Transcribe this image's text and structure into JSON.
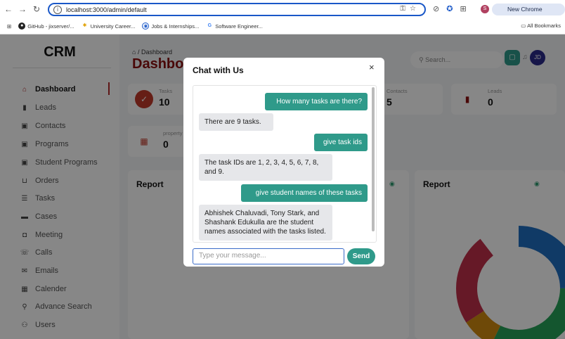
{
  "browser": {
    "url": "localhost:3000/admin/default",
    "update_label": "New Chrome available",
    "profile_initial": "S",
    "bookmarks": [
      "GitHub - jixserver/...",
      "University Career...",
      "Jobs & Internships...",
      "Software Engineer..."
    ],
    "all_bookmarks": "All Bookmarks"
  },
  "sidebar": {
    "logo": "CRM",
    "items": [
      {
        "label": "Dashboard",
        "icon": "home-icon",
        "glyph": "⌂",
        "active": true
      },
      {
        "label": "Leads",
        "icon": "bar-chart-icon",
        "glyph": "▮"
      },
      {
        "label": "Contacts",
        "icon": "contact-icon",
        "glyph": "▣"
      },
      {
        "label": "Programs",
        "icon": "program-icon",
        "glyph": "▣"
      },
      {
        "label": "Student Programs",
        "icon": "student-program-icon",
        "glyph": "▣"
      },
      {
        "label": "Orders",
        "icon": "cart-icon",
        "glyph": "⊔"
      },
      {
        "label": "Tasks",
        "icon": "task-list-icon",
        "glyph": "☰"
      },
      {
        "label": "Cases",
        "icon": "briefcase-icon",
        "glyph": "▬"
      },
      {
        "label": "Meeting",
        "icon": "video-icon",
        "glyph": "◘"
      },
      {
        "label": "Calls",
        "icon": "phone-icon",
        "glyph": "☏"
      },
      {
        "label": "Emails",
        "icon": "mail-icon",
        "glyph": "✉"
      },
      {
        "label": "Calender",
        "icon": "calendar-icon",
        "glyph": "▦"
      },
      {
        "label": "Advance Search",
        "icon": "search-icon",
        "glyph": "⚲"
      },
      {
        "label": "Users",
        "icon": "users-icon",
        "glyph": "⚇"
      }
    ]
  },
  "header": {
    "breadcrumb": "/ Dashboard",
    "title": "Dashboard",
    "search_placeholder": "Search...",
    "user_initials": "JD"
  },
  "stats": [
    {
      "label": "Tasks",
      "value": "10"
    },
    {
      "label": "Contacts",
      "value": "5"
    },
    {
      "label": "Leads",
      "value": "0"
    },
    {
      "label": "property",
      "value": "0"
    }
  ],
  "reports": {
    "left_title": "Report",
    "right_title": "Report"
  },
  "chat": {
    "title": "Chat with Us",
    "close": "×",
    "messages": [
      {
        "role": "user",
        "text": "How many tasks are there?"
      },
      {
        "role": "bot",
        "text": "There are 9 tasks."
      },
      {
        "role": "user",
        "text": "give task ids"
      },
      {
        "role": "bot",
        "text": "The task IDs are 1, 2, 3, 4, 5, 6, 7, 8, and 9."
      },
      {
        "role": "user",
        "text": "give student names of these tasks"
      },
      {
        "role": "bot",
        "text": "Abhishek Chaluvadi, Tony Stark, and Shashank Edukulla are the student names associated with the tasks listed."
      }
    ],
    "input_placeholder": "Type your message...",
    "send_label": "Send"
  },
  "colors": {
    "accent": "#2f9a8a",
    "brand": "#8a1010",
    "focus": "#3a6bc8"
  }
}
